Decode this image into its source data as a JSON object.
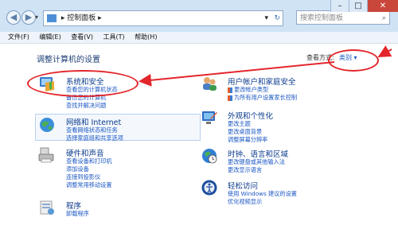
{
  "window": {
    "address": "控制面板",
    "search_placeholder": "搜索控制面板"
  },
  "menu": [
    "文件(F)",
    "编辑(E)",
    "查看(V)",
    "工具(T)",
    "帮助(H)"
  ],
  "main": {
    "heading": "调整计算机的设置",
    "view_by_label": "查看方式:",
    "view_by_value": "类别"
  },
  "categories": [
    {
      "title": "系统和安全",
      "links": [
        "查看您的计算机状态",
        "备份您的计算机",
        "查找并解决问题"
      ]
    },
    {
      "title": "网络和 Internet",
      "links": [
        "查看网络状态和任务",
        "选择家庭组和共享选项"
      ]
    },
    {
      "title": "硬件和声音",
      "links": [
        "查看设备和打印机",
        "添加设备",
        "连接到投影仪",
        "调整常用移动设置"
      ]
    },
    {
      "title": "程序",
      "links": [
        "卸载程序"
      ]
    },
    {
      "title": "用户帐户和家庭安全",
      "links": [
        "更改帐户类型",
        "为所有用户设置家长控制"
      ]
    },
    {
      "title": "外观和个性化",
      "links": [
        "更改主题",
        "更改桌面背景",
        "调整屏幕分辨率"
      ]
    },
    {
      "title": "时钟、语言和区域",
      "links": [
        "更改键盘或其他输入法",
        "更改显示语言"
      ]
    },
    {
      "title": "轻松访问",
      "links": [
        "使用 Windows 建议的设置",
        "优化视频显示"
      ]
    }
  ],
  "annotation_color": "#e3262b"
}
